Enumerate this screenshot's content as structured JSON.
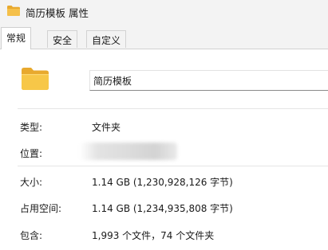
{
  "window": {
    "title": "简历模板 属性",
    "folder_icon": "folder-icon",
    "colors": {
      "folder_yellow": "#f5c04a",
      "folder_back": "#e8a92e",
      "chrome_bg": "#f3f3f3"
    }
  },
  "tabs": [
    {
      "label": "常规",
      "active": true
    },
    {
      "label": "安全",
      "active": false
    },
    {
      "label": "自定义",
      "active": false
    }
  ],
  "general": {
    "name_value": "简历模板",
    "type_label": "类型:",
    "type_value": "文件夹",
    "location_label": "位置:",
    "location_value": "",
    "size_label": "大小:",
    "size_value": "1.14 GB (1,230,928,126 字节)",
    "disk_size_label": "占用空间:",
    "disk_size_value": "1.14 GB (1,234,935,808 字节)",
    "contains_label": "包含:",
    "contains_value": "1,993 个文件，74 个文件夹"
  }
}
